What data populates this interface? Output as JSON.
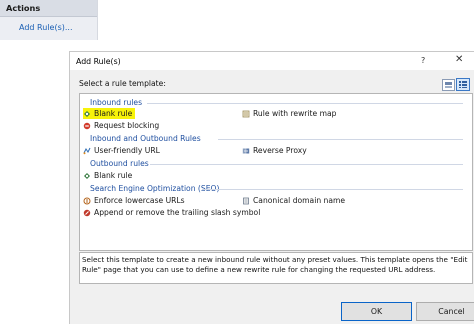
{
  "actions": {
    "title": "Actions",
    "add_rule_link": "Add Rule(s)..."
  },
  "dialog": {
    "title": "Add Rule(s)",
    "help": "?",
    "close": "✕",
    "select_label": "Select a rule template:",
    "groups": [
      {
        "header": "Inbound rules",
        "items": [
          {
            "label": "Blank rule",
            "icon": "blank-rule-icon",
            "selected": true
          },
          {
            "label": "Rule with rewrite map",
            "icon": "rewrite-map-icon"
          },
          {
            "label": "Request blocking",
            "icon": "request-blocking-icon"
          }
        ]
      },
      {
        "header": "Inbound and Outbound Rules",
        "items": [
          {
            "label": "User-friendly URL",
            "icon": "user-friendly-url-icon"
          },
          {
            "label": "Reverse Proxy",
            "icon": "reverse-proxy-icon"
          }
        ]
      },
      {
        "header": "Outbound rules",
        "items": [
          {
            "label": "Blank rule",
            "icon": "blank-rule-icon"
          }
        ]
      },
      {
        "header": "Search Engine Optimization (SEO)",
        "items": [
          {
            "label": "Enforce lowercase URLs",
            "icon": "lowercase-url-icon"
          },
          {
            "label": "Canonical domain name",
            "icon": "canonical-domain-icon"
          },
          {
            "label": "Append or remove the trailing slash symbol",
            "icon": "trailing-slash-icon"
          }
        ]
      }
    ],
    "description": "Select this template to create a new inbound rule without any preset values. This template opens the \"Edit Rule\" page that you can use to define a new rewrite rule for changing the requested URL address.",
    "ok_label": "OK",
    "cancel_label": "Cancel"
  },
  "colors": {
    "selection": "#f7f30a",
    "group_header": "#1f4fa0",
    "link": "#1a5fb4"
  }
}
